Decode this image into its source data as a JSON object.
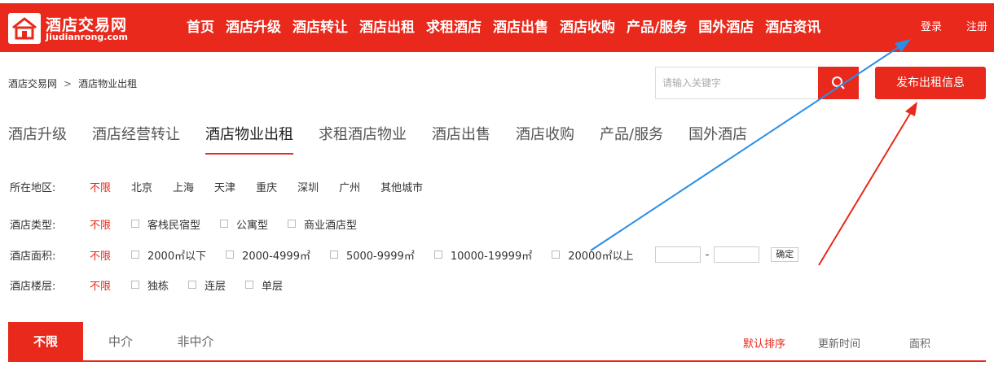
{
  "header": {
    "logo_cn": "酒店交易网",
    "logo_en": "Jiudianrong.com",
    "nav": [
      "首页",
      "酒店升级",
      "酒店转让",
      "酒店出租",
      "求租酒店",
      "酒店出售",
      "酒店收购",
      "产品/服务",
      "国外酒店",
      "酒店资讯"
    ],
    "login": "登录",
    "register": "注册",
    "brand_color": "#e8291c"
  },
  "breadcrumb": {
    "home": "酒店交易网",
    "sep": ">",
    "current": "酒店物业出租"
  },
  "search": {
    "placeholder": "请输入关键字",
    "icon": "search-icon"
  },
  "publish_label": "发布出租信息",
  "category_tabs": [
    "酒店升级",
    "酒店经营转让",
    "酒店物业出租",
    "求租酒店物业",
    "酒店出售",
    "酒店收购",
    "产品/服务",
    "国外酒店"
  ],
  "category_active": "酒店物业出租",
  "filters": {
    "region": {
      "label": "所在地区:",
      "options": [
        "不限",
        "北京",
        "上海",
        "天津",
        "重庆",
        "深圳",
        "广州",
        "其他城市"
      ]
    },
    "type": {
      "label": "酒店类型:",
      "all": "不限",
      "options": [
        "客栈民宿型",
        "公寓型",
        "商业酒店型"
      ]
    },
    "area": {
      "label": "酒店面积:",
      "all": "不限",
      "options": [
        "2000㎡以下",
        "2000-4999㎡",
        "5000-9999㎡",
        "10000-19999㎡",
        "20000㎡以上"
      ],
      "range_sep": "-",
      "confirm": "确定"
    },
    "floor": {
      "label": "酒店楼层:",
      "all": "不限",
      "options": [
        "独栋",
        "连层",
        "单层"
      ]
    }
  },
  "agent_tabs": [
    "不限",
    "中介",
    "非中介"
  ],
  "sort_options": [
    "默认排序",
    "更新时间",
    "面积"
  ]
}
